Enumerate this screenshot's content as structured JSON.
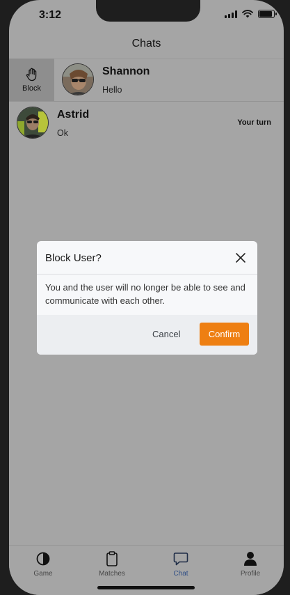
{
  "status_bar": {
    "time": "3:12",
    "battery_level": 0.9
  },
  "header": {
    "title": "Chats"
  },
  "chats": [
    {
      "name": "Shannon",
      "last_message": "Hello",
      "action_label": "Block",
      "turn_status": ""
    },
    {
      "name": "Astrid",
      "last_message": "Ok",
      "turn_status": "Your turn"
    }
  ],
  "modal": {
    "title": "Block User?",
    "body": "You and the user will no longer be able to see and communicate with each other.",
    "cancel_label": "Cancel",
    "confirm_label": "Confirm",
    "confirm_color": "#ee7f12"
  },
  "tabs": [
    {
      "label": "Game",
      "icon": "game-icon",
      "active": false
    },
    {
      "label": "Matches",
      "icon": "matches-icon",
      "active": false
    },
    {
      "label": "Chat",
      "icon": "chat-icon",
      "active": true
    },
    {
      "label": "Profile",
      "icon": "profile-icon",
      "active": false
    }
  ]
}
